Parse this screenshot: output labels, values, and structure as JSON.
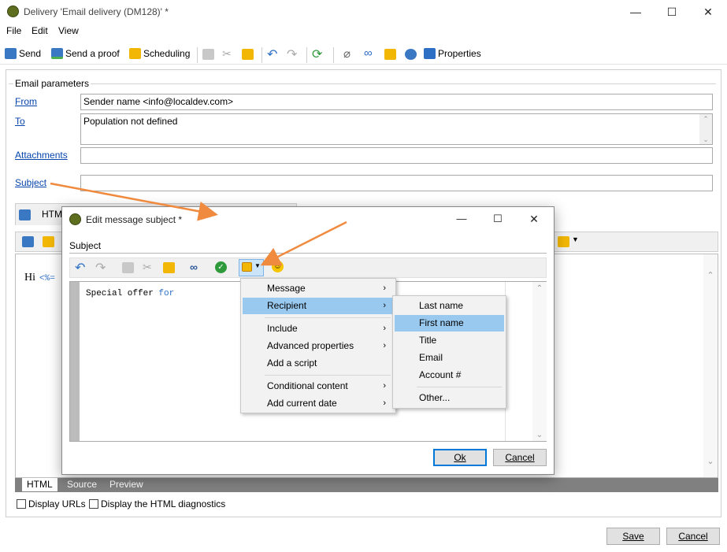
{
  "window": {
    "title": "Delivery 'Email delivery (DM128)' *",
    "minimize": "—",
    "maximize": "☐",
    "close": "✕"
  },
  "menubar": {
    "file": "File",
    "edit": "Edit",
    "view": "View"
  },
  "toolbar": {
    "send": "Send",
    "send_proof": "Send a proof",
    "scheduling": "Scheduling",
    "properties": "Properties"
  },
  "email_params": {
    "legend": "Email parameters",
    "from_label": "From",
    "from_value": "Sender name <info@localdev.com>",
    "to_label": "To",
    "to_value": "Population not defined",
    "attachments_label": "Attachments",
    "attachments_value": "",
    "subject_label": "Subject",
    "subject_value": ""
  },
  "content": {
    "tab_html_top": "HTML",
    "body_start": "Hi",
    "body_code": "<%="
  },
  "bottom_tabs": [
    "HTML",
    "Source",
    "Preview"
  ],
  "options": {
    "display_urls": "Display URLs",
    "html_diagnostics": "Display the HTML diagnostics"
  },
  "footer": {
    "save": "Save",
    "cancel": "Cancel"
  },
  "dialog": {
    "title": "Edit message subject *",
    "section": "Subject",
    "text_plain": "Special offer ",
    "text_keyword": "for",
    "ok": "Ok",
    "cancel": "Cancel"
  },
  "menu": {
    "items": [
      "Message",
      "Recipient",
      "Include",
      "Advanced properties",
      "Add a script",
      "Conditional content",
      "Add current date"
    ]
  },
  "submenu": {
    "items": [
      "Last name",
      "First name",
      "Title",
      "Email",
      "Account #",
      "Other..."
    ]
  },
  "colors": {
    "accent": "#99c9ef",
    "arrow": "#f08a3e",
    "link": "#0645ad"
  }
}
